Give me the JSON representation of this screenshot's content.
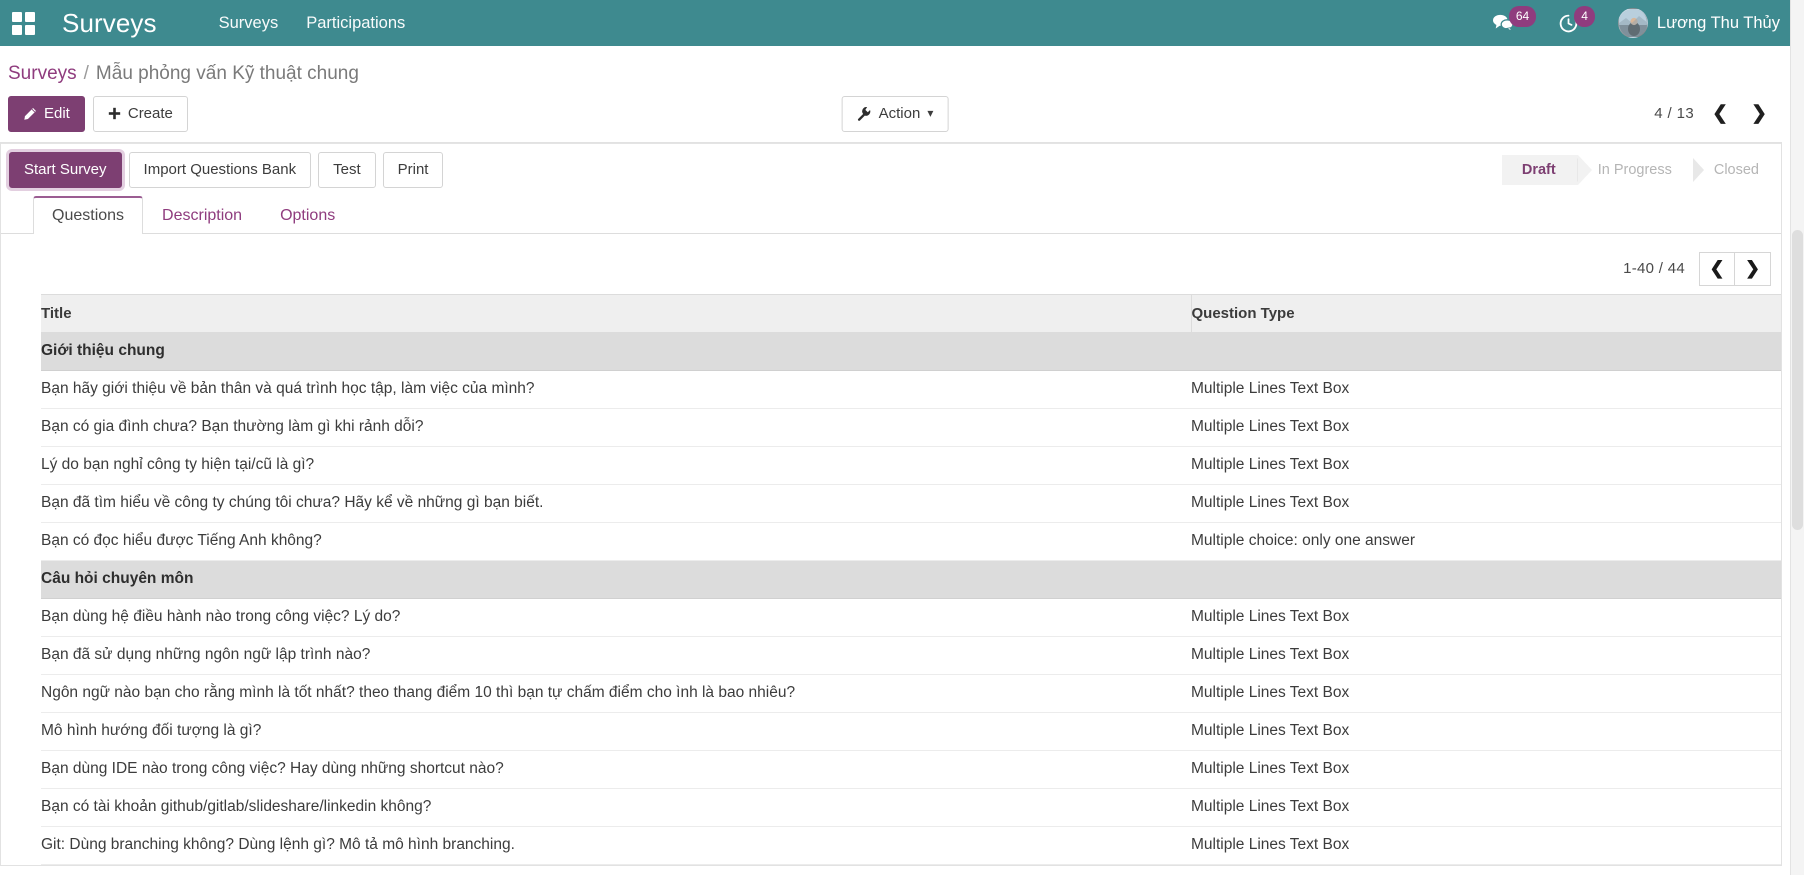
{
  "navbar": {
    "apps_icon": "apps-grid-icon",
    "brand": "Surveys",
    "menu": [
      {
        "label": "Surveys"
      },
      {
        "label": "Participations"
      }
    ],
    "systray": {
      "messages_icon": "chat-bubble-icon",
      "messages_count": "64",
      "activity_icon": "clock-activity-icon",
      "activity_count": "4",
      "user_name": "Lương Thu Thủy",
      "avatar_icon": "user-avatar"
    },
    "background_color": "#3e8a8f"
  },
  "breadcrumb": {
    "root": "Surveys",
    "separator": "/",
    "current": "Mẫu phỏng vấn Kỹ thuật chung"
  },
  "control_panel": {
    "edit_label": "Edit",
    "edit_icon": "pencil-icon",
    "create_label": "Create",
    "create_icon": "plus-icon",
    "action_label": "Action",
    "action_icon": "wrench-icon",
    "action_caret": "▾",
    "record_pager": "4 / 13",
    "prev_icon": "chevron-left-icon",
    "next_icon": "chevron-right-icon"
  },
  "statusbar_row": {
    "buttons": [
      {
        "label": "Start Survey",
        "style": "primary-focused"
      },
      {
        "label": "Import Questions Bank",
        "style": "default"
      },
      {
        "label": "Test",
        "style": "default"
      },
      {
        "label": "Print",
        "style": "default"
      }
    ],
    "stages": [
      {
        "label": "Draft",
        "active": true
      },
      {
        "label": "In Progress",
        "active": false
      },
      {
        "label": "Closed",
        "active": false
      }
    ],
    "active_color": "#7d3f72"
  },
  "tabs": [
    {
      "label": "Questions",
      "active": true
    },
    {
      "label": "Description",
      "active": false
    },
    {
      "label": "Options",
      "active": false
    }
  ],
  "list": {
    "pager_value": "1-40 / 44",
    "prev_icon": "chevron-left-icon",
    "next_icon": "chevron-right-icon",
    "columns": {
      "title": "Title",
      "question_type": "Question Type"
    },
    "rows": [
      {
        "kind": "section",
        "title": "Giới thiệu chung",
        "type": ""
      },
      {
        "kind": "question",
        "title": "Bạn hãy giới thiệu về bản thân và quá trình học tập, làm việc của mình?",
        "type": "Multiple Lines Text Box"
      },
      {
        "kind": "question",
        "title": "Bạn có gia đình chưa? Bạn thường làm gì khi rảnh dỗi?",
        "type": "Multiple Lines Text Box"
      },
      {
        "kind": "question",
        "title": "Lý do bạn nghỉ công ty hiện tại/cũ là gì?",
        "type": "Multiple Lines Text Box"
      },
      {
        "kind": "question",
        "title": "Bạn đã tìm hiểu về công ty chúng tôi chưa? Hãy kể về những gì bạn biết.",
        "type": "Multiple Lines Text Box"
      },
      {
        "kind": "question",
        "title": "Bạn có đọc hiểu được Tiếng Anh không?",
        "type": "Multiple choice: only one answer"
      },
      {
        "kind": "section",
        "title": "Câu hỏi chuyên môn",
        "type": ""
      },
      {
        "kind": "question",
        "title": "Bạn dùng hệ điều hành nào trong công việc? Lý do?",
        "type": "Multiple Lines Text Box"
      },
      {
        "kind": "question",
        "title": "Bạn đã sử dụng những ngôn ngữ lập trình nào?",
        "type": "Multiple Lines Text Box"
      },
      {
        "kind": "question",
        "title": "Ngôn ngữ nào bạn cho rằng mình là tốt nhất? theo thang điểm 10 thì bạn tự chấm điểm cho ình là bao nhiêu?",
        "type": "Multiple Lines Text Box"
      },
      {
        "kind": "question",
        "title": "Mô hình hướng đối tượng là gì?",
        "type": "Multiple Lines Text Box"
      },
      {
        "kind": "question",
        "title": "Bạn dùng IDE nào trong công việc? Hay dùng những shortcut nào?",
        "type": "Multiple Lines Text Box"
      },
      {
        "kind": "question",
        "title": "Bạn có tài khoản github/gitlab/slideshare/linkedin không?",
        "type": "Multiple Lines Text Box"
      },
      {
        "kind": "question",
        "title": "Git: Dùng branching không? Dùng lệnh gì? Mô tả mô hình branching.",
        "type": "Multiple Lines Text Box"
      }
    ]
  }
}
